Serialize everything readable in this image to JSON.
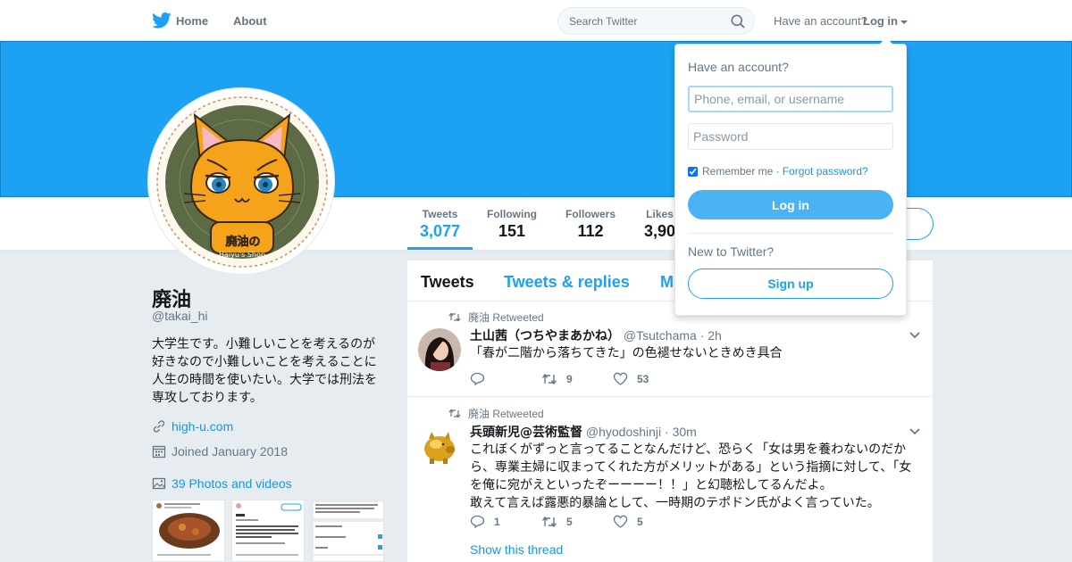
{
  "colors": {
    "brand": "#1da1f2",
    "banner": "#1da1f2",
    "link": "#1b95e0",
    "like_icon": "#657786"
  },
  "nav": {
    "home_label": "Home",
    "about_label": "About",
    "search_placeholder": "Search Twitter",
    "have_account_text": "Have an account?",
    "login_label": "Log in",
    "icons": [
      "twitter-bird-icon",
      "search-icon",
      "caret-down-icon"
    ]
  },
  "stats": [
    {
      "label": "Tweets",
      "value": "3,077"
    },
    {
      "label": "Following",
      "value": "151"
    },
    {
      "label": "Followers",
      "value": "112"
    },
    {
      "label": "Likes",
      "value": "3,90"
    }
  ],
  "profile": {
    "name": "廃油",
    "handle": "@takai_hi",
    "bio": "大学生です。小難しいことを考えるのが好きなので小難しいことを考えることに人生の時間を使いたい。大学では刑法を専攻しております。",
    "url": "high-u.com",
    "joined": "Joined January 2018",
    "photos_label": "39 Photos and videos",
    "avatar_stamp_text": "廃油の",
    "avatar_stamp_sub": "Haiyu's Shop",
    "icons": [
      "link-icon",
      "calendar-icon",
      "photo-icon"
    ]
  },
  "timeline": {
    "tabs": [
      "Tweets",
      "Tweets & replies",
      "M"
    ],
    "tweets": [
      {
        "retweeted_by": "廃油 Retweeted",
        "display_name": "土山茜（つちやまあかね）",
        "screen_name": "@Tsutchama",
        "time": "· 2h",
        "text": "「春が二階から落ちてきた」の色褪せないときめき具合",
        "replies": "",
        "retweets": "9",
        "likes": "53"
      },
      {
        "retweeted_by": "廃油 Retweeted",
        "display_name": "兵頭新児@芸術監督",
        "screen_name": "@hyodoshinji",
        "time": "· 30m",
        "text": "これぼくがずっと言ってることなんだけど、恐らく「女は男を養わないのだから、専業主婦に収まってくれた方がメリットがある」という指摘に対して、「女を俺に宛がえといったぞーーーー！！」と幻聴松してるんだよ。\n敢えて言えば露悪的暴論として、一時期のテポドン氏がよく言っていた。",
        "replies": "1",
        "retweets": "5",
        "likes": "5",
        "show_thread": "Show this thread"
      }
    ]
  },
  "login_dropdown": {
    "title": "Have an account?",
    "username_placeholder": "Phone, email, or username",
    "password_placeholder": "Password",
    "remember_label": "Remember me ·",
    "forgot_label": "Forgot password?",
    "login_button": "Log in",
    "new_text": "New to Twitter?",
    "signup_button": "Sign up"
  }
}
